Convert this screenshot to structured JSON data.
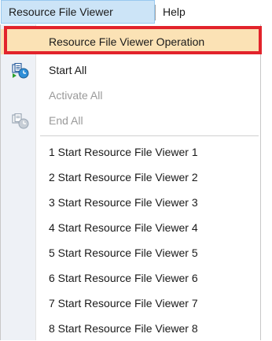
{
  "menubar": {
    "items": [
      {
        "label": "Resource File Viewer"
      },
      {
        "label": "Help"
      }
    ]
  },
  "dropdown": {
    "highlighted_label": "Resource File Viewer Operation",
    "start_all": {
      "label": "Start All",
      "icon": "start-all-icon"
    },
    "activate_all": {
      "label": "Activate All"
    },
    "end_all": {
      "label": "End All",
      "icon": "end-all-icon"
    },
    "viewers": [
      "1 Start Resource File Viewer 1",
      "2 Start Resource File Viewer 2",
      "3 Start Resource File Viewer 3",
      "4 Start Resource File Viewer 4",
      "5 Start Resource File Viewer 5",
      "6 Start Resource File Viewer 6",
      "7 Start Resource File Viewer 7",
      "8 Start Resource File Viewer 8"
    ]
  },
  "colors": {
    "highlight": "#fbe2b5",
    "focus_outline": "#e2232b",
    "menubar_active": "#cce4f7"
  }
}
